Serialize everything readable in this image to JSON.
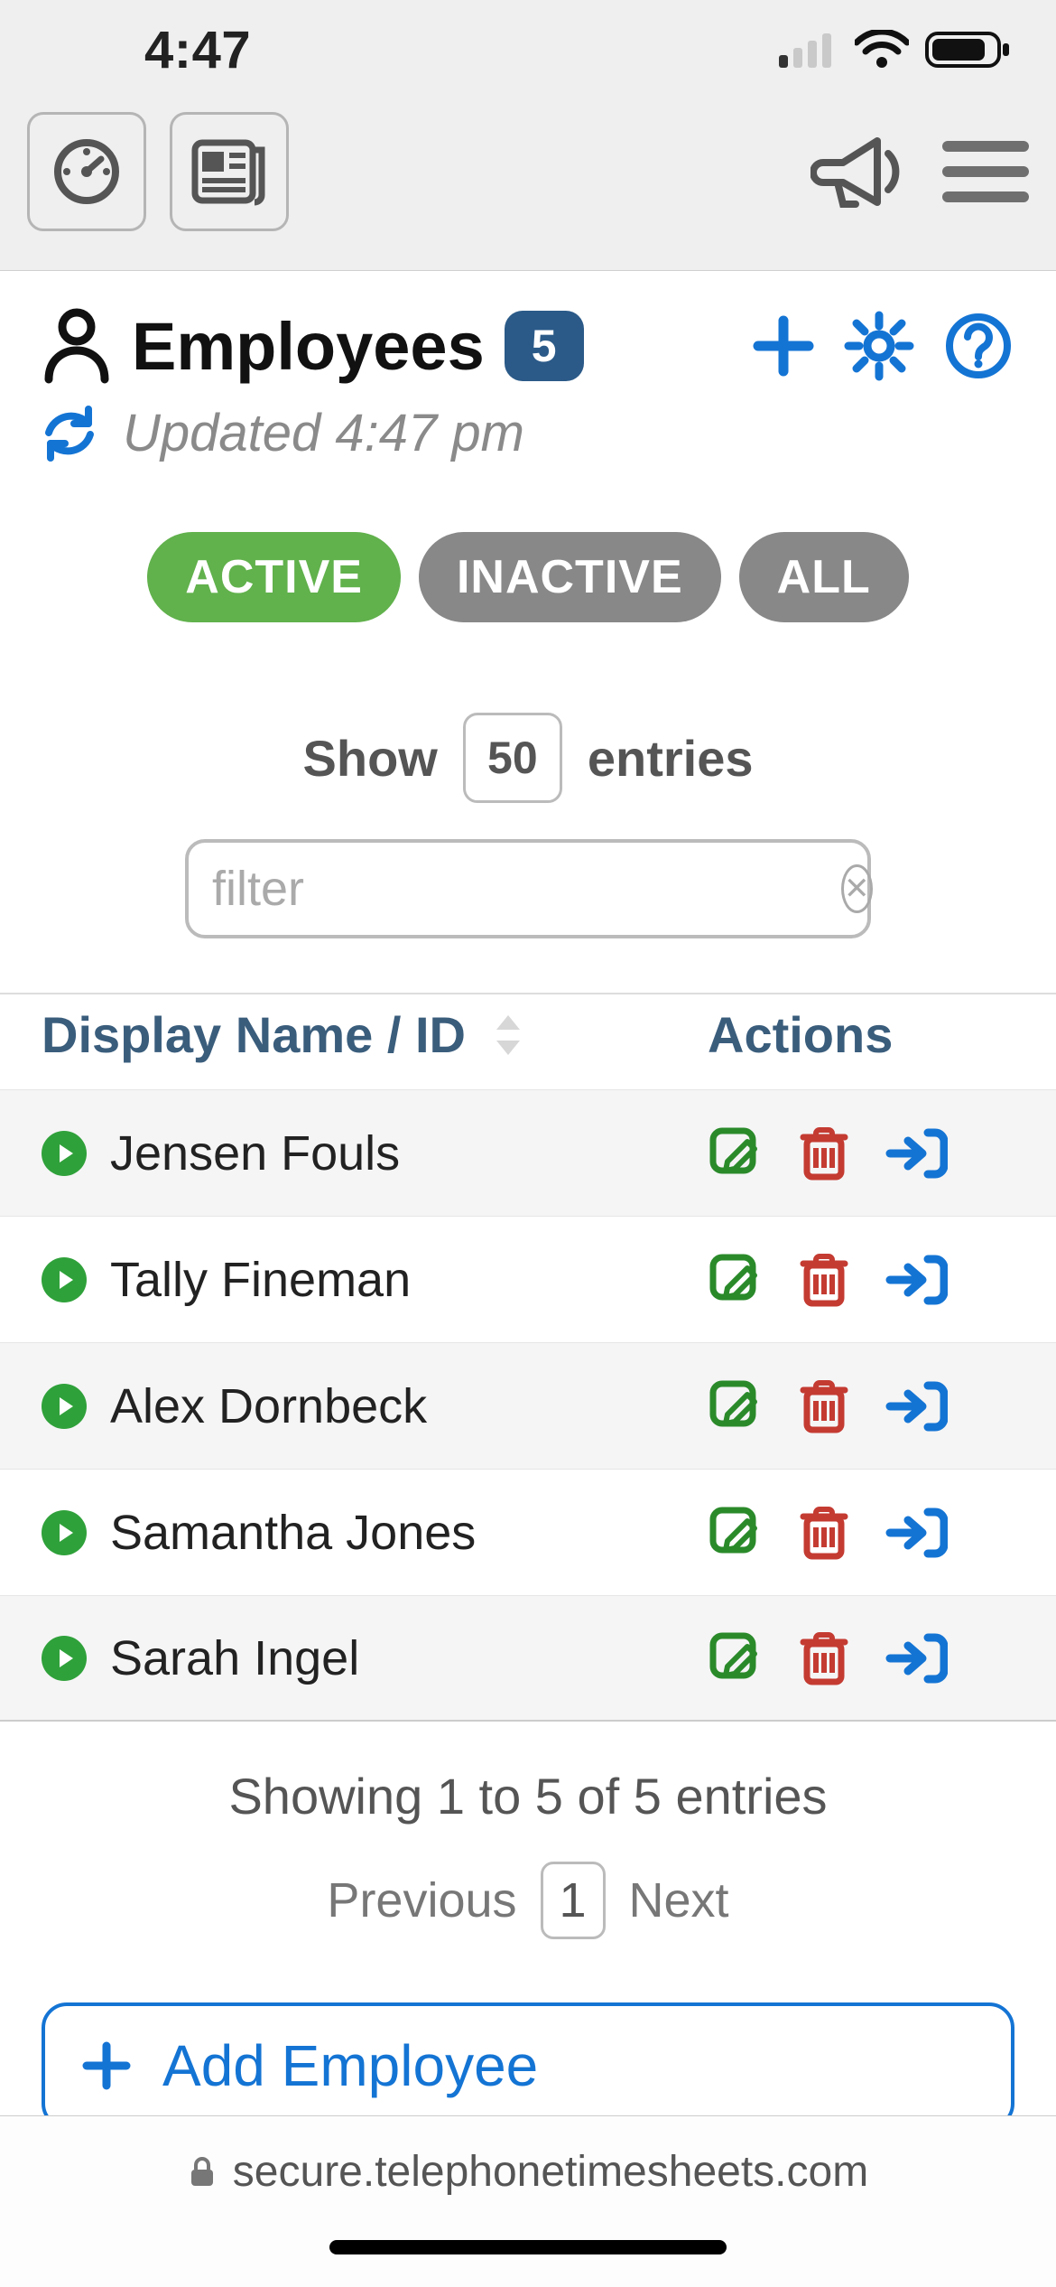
{
  "status": {
    "time": "4:47"
  },
  "header": {
    "title": "Employees",
    "count": "5",
    "updated": "Updated 4:47 pm"
  },
  "filters": {
    "active": "ACTIVE",
    "inactive": "INACTIVE",
    "all": "ALL"
  },
  "showEntries": {
    "show_label": "Show",
    "value": "50",
    "entries_label": "entries"
  },
  "filterInput": {
    "placeholder": "filter"
  },
  "table": {
    "header_name": "Display Name / ID",
    "header_actions": "Actions",
    "rows": [
      {
        "name": "Jensen Fouls"
      },
      {
        "name": "Tally Fineman"
      },
      {
        "name": "Alex Dornbeck"
      },
      {
        "name": "Samantha Jones"
      },
      {
        "name": "Sarah Ingel"
      }
    ]
  },
  "pagination": {
    "showing": "Showing 1 to 5 of 5 entries",
    "previous": "Previous",
    "page": "1",
    "next": "Next"
  },
  "addEmployee": {
    "label": "Add Employee"
  },
  "browser": {
    "url": "secure.telephonetimesheets.com"
  }
}
